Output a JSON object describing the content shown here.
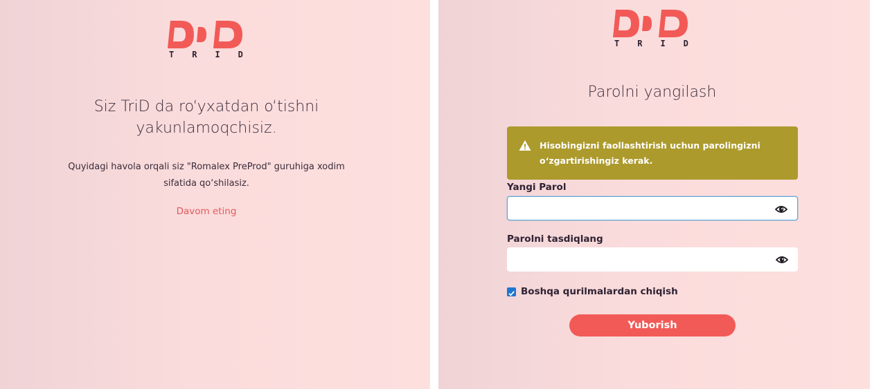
{
  "brand": {
    "logo_text": "TRID",
    "color_primary": "#f25a57"
  },
  "left_panel": {
    "title": "Siz TriD da ro‘yxatdan o‘tishni yakunlamoqchisiz.",
    "description": "Quyidagi havola orqali siz \"Romalex PreProd\" guruhiga xodim sifatida qo‘shilasiz.",
    "continue_link": "Davom eting"
  },
  "right_panel": {
    "title": "Parolni yangilash",
    "alert": {
      "icon": "warning-icon",
      "text": "Hisobingizni faollashtirish uchun parolingizni o‘zgartirishingiz kerak.",
      "color": "#ac9a2c"
    },
    "new_password": {
      "label": "Yangi Parol",
      "value": "",
      "icon": "eye-icon"
    },
    "confirm_password": {
      "label": "Parolni tasdiqlang",
      "value": "",
      "icon": "eye-icon"
    },
    "logout_other_devices": {
      "label": "Boshqa qurilmalardan chiqish",
      "checked": true
    },
    "submit_label": "Yuborish"
  }
}
